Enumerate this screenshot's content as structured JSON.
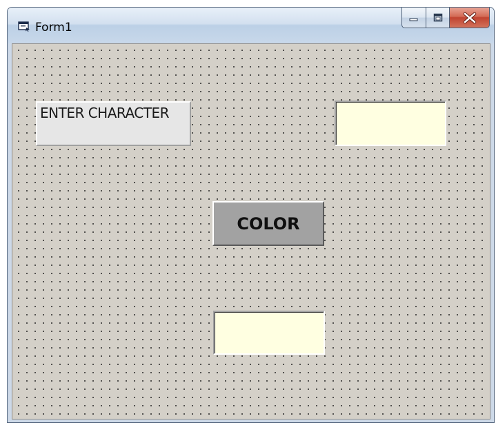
{
  "window": {
    "title": "Form1",
    "icon": "form-window-icon",
    "controls": {
      "minimize": "minimize-icon",
      "maximize": "maximize-icon",
      "close": "close-icon"
    }
  },
  "form": {
    "label_text": "ENTER CHARACTER",
    "input_value": "",
    "button_label": "COLOR",
    "output_value": ""
  },
  "colors": {
    "form_background": "#d4d0c8",
    "label_background": "#e6e6e6",
    "textbox_background": "#ffffe1",
    "button_background": "#a2a2a2",
    "close_button": "#c04330"
  }
}
